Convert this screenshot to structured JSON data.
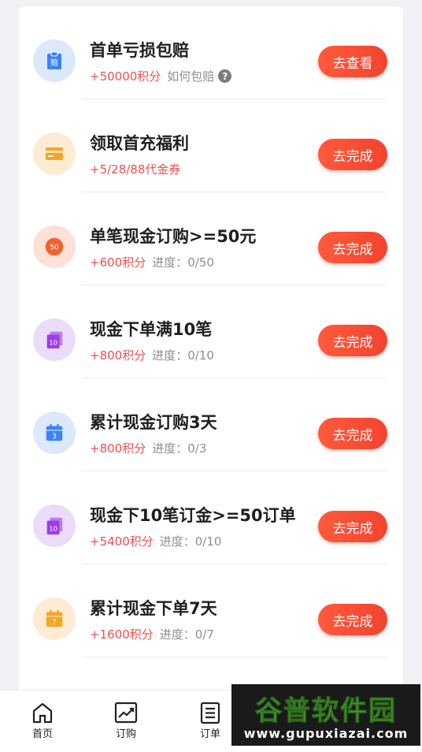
{
  "colors": {
    "accent": "#f2432f",
    "reward": "#ef4f4f",
    "muted": "#8f8f8f",
    "page_bg": "#f1f2f5"
  },
  "tasks": [
    {
      "title": "首单亏损包赔",
      "reward": "+50000积分",
      "help_text": "如何包赔",
      "button": "去查看",
      "icon": "clipboard-icon",
      "icon_label": "赔",
      "icon_bg": "#dce9fb",
      "icon_color": "#3b82f6"
    },
    {
      "title": "领取首充福利",
      "reward": "+5/28/88代金券",
      "button": "去完成",
      "icon": "card-icon",
      "icon_label": "",
      "icon_bg": "#fdecd3",
      "icon_color": "#f5a623"
    },
    {
      "title": "单笔现金订购>=50元",
      "reward": "+600积分",
      "progress_label": "进度：",
      "progress_value": "0/50",
      "button": "去完成",
      "icon": "coin-icon",
      "icon_label": "50",
      "icon_bg": "#fde0d6",
      "icon_color": "#f2622f"
    },
    {
      "title": "现金下单满10笔",
      "reward": "+800积分",
      "progress_label": "进度：",
      "progress_value": "0/10",
      "button": "去完成",
      "icon": "stack-icon",
      "icon_label": "10",
      "icon_bg": "#ecdcfb",
      "icon_color": "#9b3fe6"
    },
    {
      "title": "累计现金订购3天",
      "reward": "+800积分",
      "progress_label": "进度：",
      "progress_value": "0/3",
      "button": "去完成",
      "icon": "calendar-icon",
      "icon_label": "3",
      "icon_bg": "#dce9fb",
      "icon_color": "#3b82f6"
    },
    {
      "title": "现金下10笔订金>=50订单",
      "reward": "+5400积分",
      "progress_label": "进度：",
      "progress_value": "0/10",
      "button": "去完成",
      "icon": "stack-icon",
      "icon_label": "10",
      "icon_bg": "#ecdcfb",
      "icon_color": "#9b3fe6"
    },
    {
      "title": "累计现金下单7天",
      "reward": "+1600积分",
      "progress_label": "进度：",
      "progress_value": "0/7",
      "button": "去完成",
      "icon": "calendar-icon",
      "icon_label": "7",
      "icon_bg": "#fdecd3",
      "icon_color": "#f5a623"
    }
  ],
  "tabbar": {
    "items": [
      {
        "label": "首页",
        "icon": "home-icon"
      },
      {
        "label": "订购",
        "icon": "chart-icon"
      },
      {
        "label": "订单",
        "icon": "list-icon"
      }
    ]
  },
  "watermark": {
    "title": "谷普软件园",
    "url": "www.gupuxiazai.com"
  }
}
